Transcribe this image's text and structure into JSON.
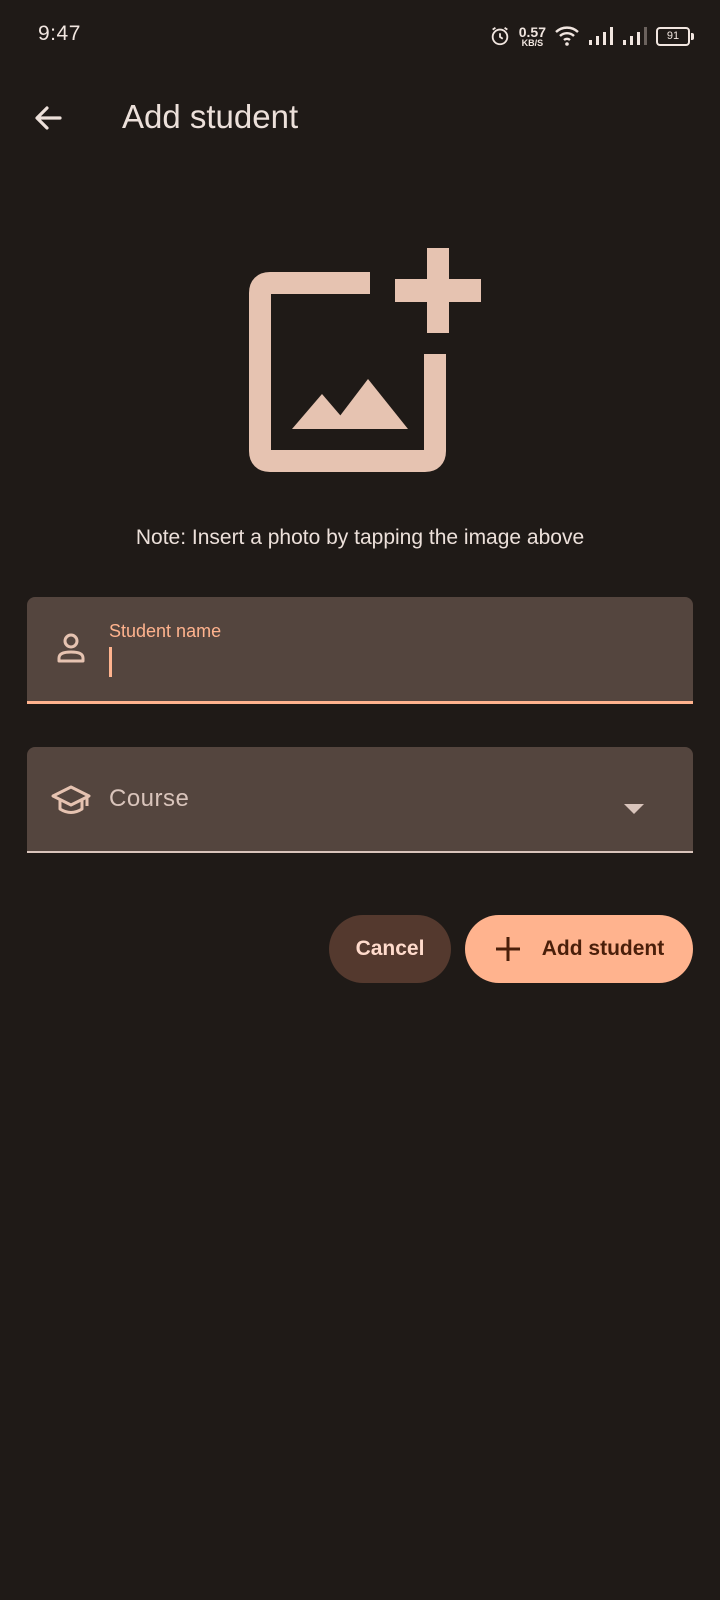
{
  "status_bar": {
    "time": "9:47",
    "net_speed_value": "0.57",
    "net_speed_unit": "KB/S",
    "battery": "91",
    "icons": [
      "alarm-icon",
      "wifi-icon",
      "signal-icon",
      "signal-icon",
      "battery-icon"
    ]
  },
  "app_bar": {
    "back_icon": "arrow-back-icon",
    "title": "Add student"
  },
  "photo": {
    "icon": "add-photo-icon",
    "note": "Note: Insert a photo by tapping the image above"
  },
  "form": {
    "name_field": {
      "icon": "person-icon",
      "label": "Student name",
      "value": ""
    },
    "course_field": {
      "icon": "school-icon",
      "placeholder": "Course",
      "dropdown_icon": "arrow-drop-down-icon"
    }
  },
  "actions": {
    "cancel_label": "Cancel",
    "add_label": "Add student",
    "add_icon": "plus-icon"
  },
  "colors": {
    "background": "#1f1a17",
    "surface": "#54453e",
    "accent": "#ffb38e",
    "on_accent": "#4a1f0a",
    "icon_tint": "#e6c3b1"
  }
}
